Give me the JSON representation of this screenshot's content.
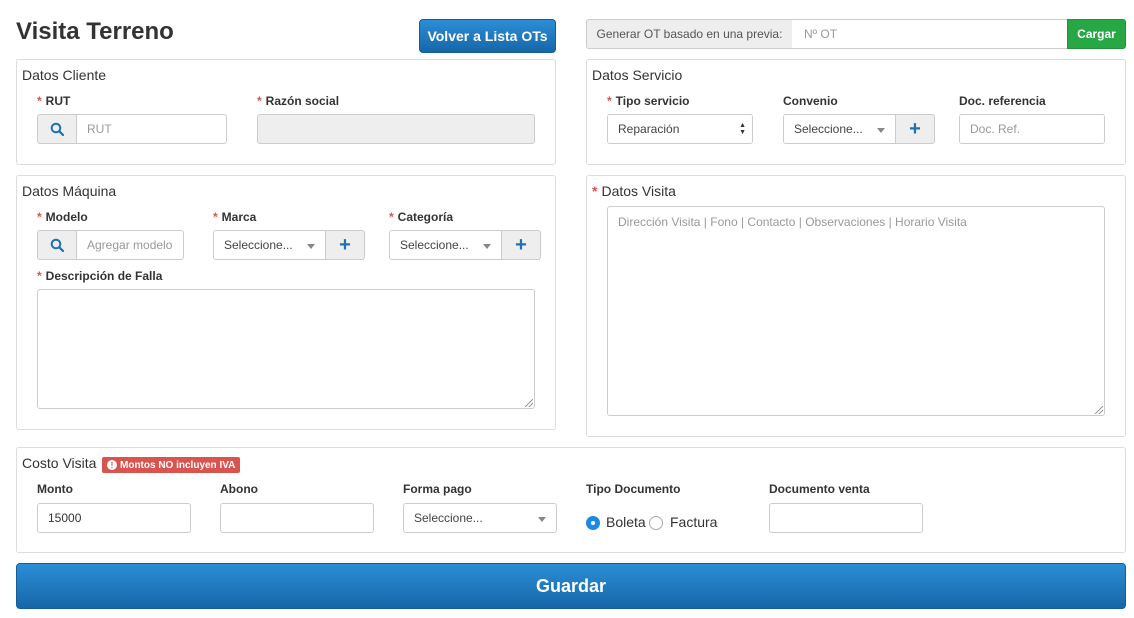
{
  "page": {
    "title": "Visita Terreno",
    "back_button": "Volver a Lista OTs",
    "generate": {
      "label": "Generar OT basado en una previa:",
      "placeholder": "Nº OT",
      "button": "Cargar"
    },
    "save_button": "Guardar"
  },
  "datos_cliente": {
    "title": "Datos Cliente",
    "rut": {
      "label": "RUT",
      "placeholder": "RUT"
    },
    "razon_social": {
      "label": "Razón social",
      "value": ""
    }
  },
  "datos_servicio": {
    "title": "Datos Servicio",
    "tipo_servicio": {
      "label": "Tipo servicio",
      "value": "Reparación"
    },
    "convenio": {
      "label": "Convenio",
      "value": "Seleccione..."
    },
    "doc_referencia": {
      "label": "Doc. referencia",
      "placeholder": "Doc. Ref."
    }
  },
  "datos_maquina": {
    "title": "Datos Máquina",
    "modelo": {
      "label": "Modelo",
      "placeholder": "Agregar modelo"
    },
    "marca": {
      "label": "Marca",
      "value": "Seleccione..."
    },
    "categoria": {
      "label": "Categoría",
      "value": "Seleccione..."
    },
    "descripcion": {
      "label": "Descripción de Falla",
      "value": ""
    }
  },
  "datos_visita": {
    "title": "Datos Visita",
    "placeholder": "Dirección Visita | Fono | Contacto | Observaciones | Horario Visita"
  },
  "costo_visita": {
    "title": "Costo Visita",
    "warning": "Montos NO incluyen IVA",
    "monto": {
      "label": "Monto",
      "value": "15000"
    },
    "abono": {
      "label": "Abono",
      "value": ""
    },
    "forma_pago": {
      "label": "Forma pago",
      "value": "Seleccione..."
    },
    "tipo_documento": {
      "label": "Tipo Documento",
      "options": [
        "Boleta",
        "Factura"
      ],
      "selected": "Boleta"
    },
    "documento_venta": {
      "label": "Documento venta",
      "value": ""
    }
  },
  "required_marker": "*",
  "colors": {
    "primary": "#1e70b7",
    "success": "#28a745",
    "danger": "#d9534f"
  },
  "icons": {
    "search": "search-icon",
    "plus": "plus-icon",
    "warning": "exclamation-circle-icon"
  }
}
